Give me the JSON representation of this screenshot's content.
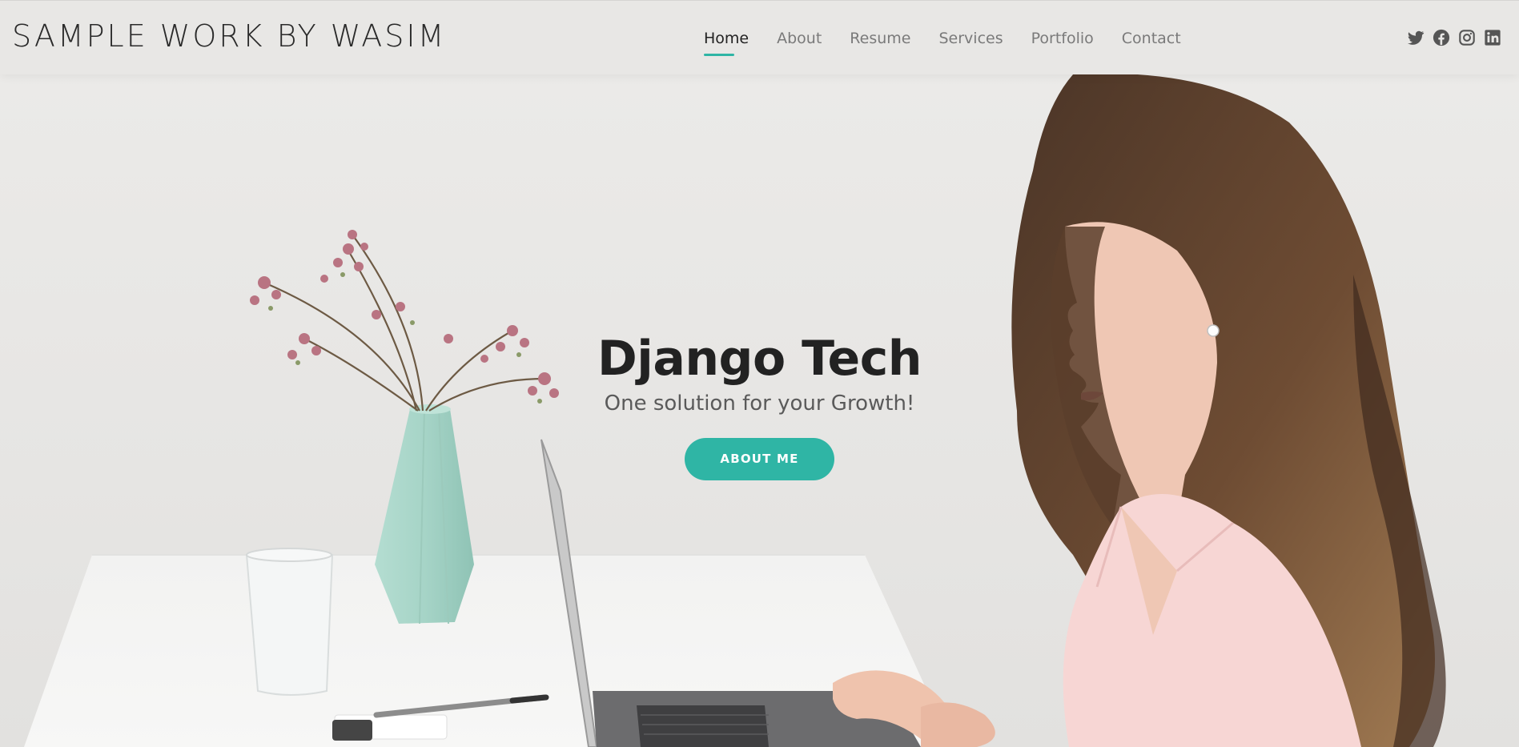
{
  "brand": {
    "title": "SAMPLE WORK BY WASIM"
  },
  "nav": {
    "items": [
      {
        "label": "Home",
        "active": true
      },
      {
        "label": "About",
        "active": false
      },
      {
        "label": "Resume",
        "active": false
      },
      {
        "label": "Services",
        "active": false
      },
      {
        "label": "Portfolio",
        "active": false
      },
      {
        "label": "Contact",
        "active": false
      }
    ]
  },
  "socials": [
    {
      "icon": "twitter-icon"
    },
    {
      "icon": "facebook-icon"
    },
    {
      "icon": "instagram-icon"
    },
    {
      "icon": "linkedin-icon"
    }
  ],
  "hero": {
    "title": "Django Tech",
    "subtitle": "One solution for your Growth!",
    "cta_label": "ABOUT ME"
  },
  "colors": {
    "accent": "#2fb5a5",
    "heading": "#222222",
    "nav_text": "#7a7a7a"
  }
}
